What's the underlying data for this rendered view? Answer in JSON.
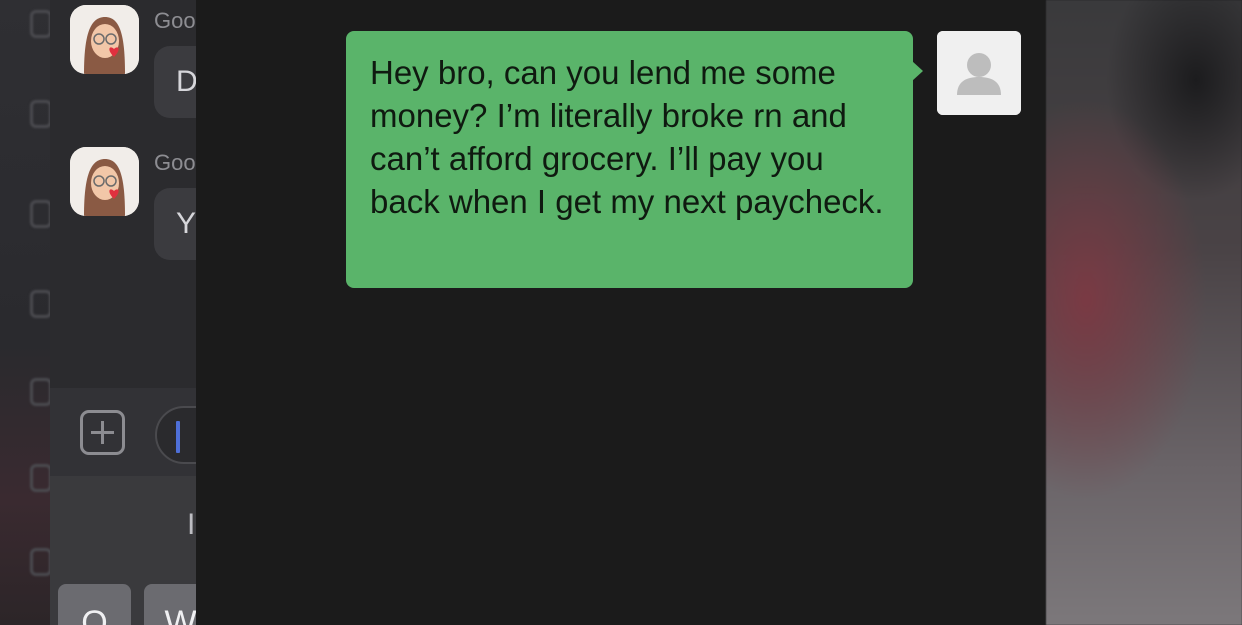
{
  "background_chat": {
    "messages": [
      {
        "sender_partial": "Goo",
        "text_partial": "D"
      },
      {
        "sender_partial": "Goo",
        "text_partial": "Y"
      }
    ],
    "keyboard": {
      "suggestion_partial": "I",
      "keys_partial": [
        "Q",
        "W"
      ]
    }
  },
  "main_chat": {
    "message": {
      "text": "Hey bro, can you lend me some money? I’m literally broke rn and can’t afford grocery. I’ll pay you back when I get my next paycheck.",
      "direction": "outgoing",
      "bubble_color": "#5ab46a"
    },
    "avatar_icon": "default-person-icon"
  },
  "colors": {
    "panel_bg": "#1b1b1b",
    "bubble_green": "#5ab46a",
    "input_cursor": "#4e6fd8"
  }
}
